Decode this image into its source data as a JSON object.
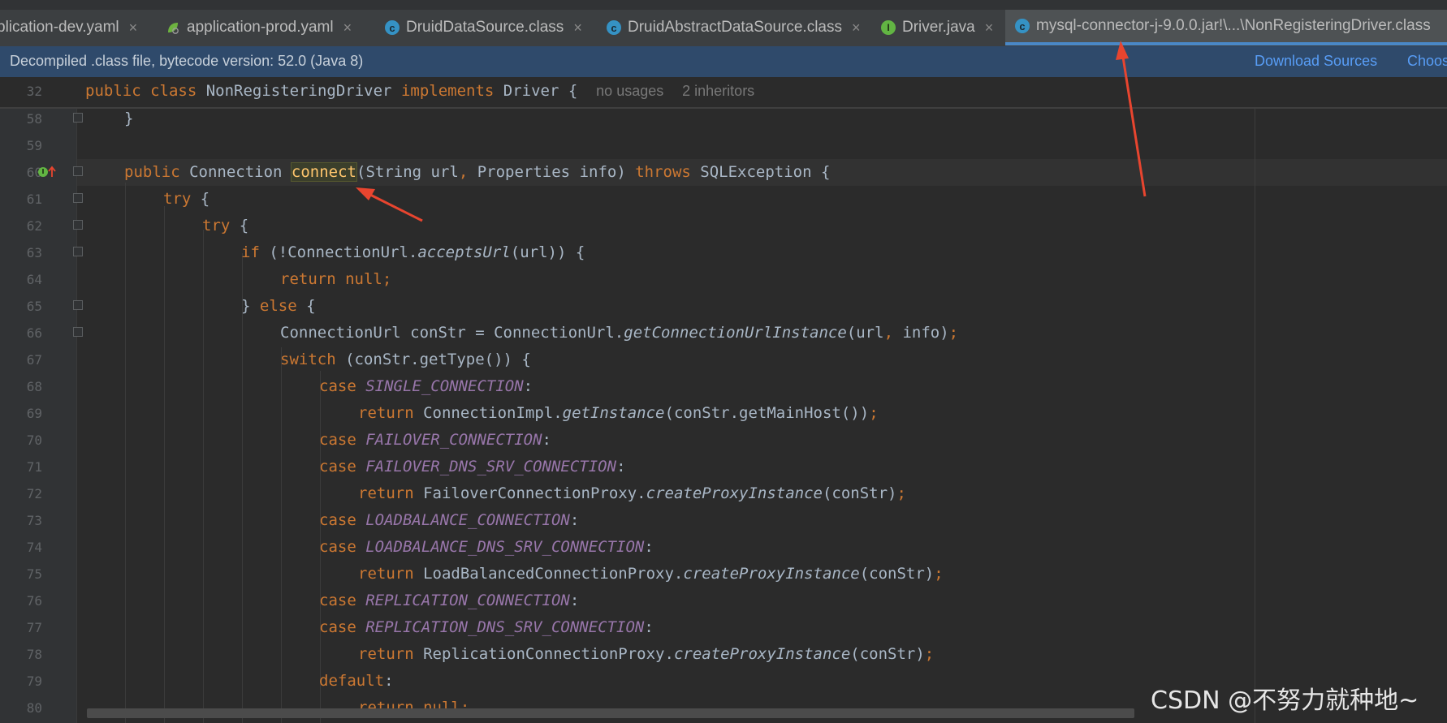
{
  "tabs": [
    {
      "label": "plication-dev.yaml",
      "icon": "none",
      "close": "×"
    },
    {
      "label": "application-prod.yaml",
      "icon": "spring-leaf-icon",
      "close": "×"
    },
    {
      "label": "DruidDataSource.class",
      "icon": "class-icon",
      "close": "×"
    },
    {
      "label": "DruidAbstractDataSource.class",
      "icon": "class-icon",
      "close": "×"
    },
    {
      "label": "Driver.java",
      "icon": "interface-icon",
      "close": "×"
    },
    {
      "label": "mysql-connector-j-9.0.0.jar!\\...\\NonRegisteringDriver.class",
      "icon": "class-icon",
      "active": true
    }
  ],
  "banner": {
    "text": "Decompiled .class file, bytecode version: 52.0 (Java 8)",
    "download_sources": "Download Sources",
    "choose_sources": "Choos"
  },
  "sticky": {
    "line": "32",
    "hint_usages": "no usages",
    "hint_inheritors": "2 inheritors"
  },
  "line_numbers": [
    "58",
    "59",
    "60",
    "61",
    "62",
    "63",
    "64",
    "65",
    "66",
    "67",
    "68",
    "69",
    "70",
    "71",
    "72",
    "73",
    "74",
    "75",
    "76",
    "77",
    "78",
    "79",
    "80"
  ],
  "watermark": "CSDN @不努力就种地~",
  "colors": {
    "keyword": "#cc7832",
    "constant": "#9876aa",
    "method": "#ffc66d",
    "text": "#a9b7c6",
    "annotation_arrow": "#e8452f"
  }
}
